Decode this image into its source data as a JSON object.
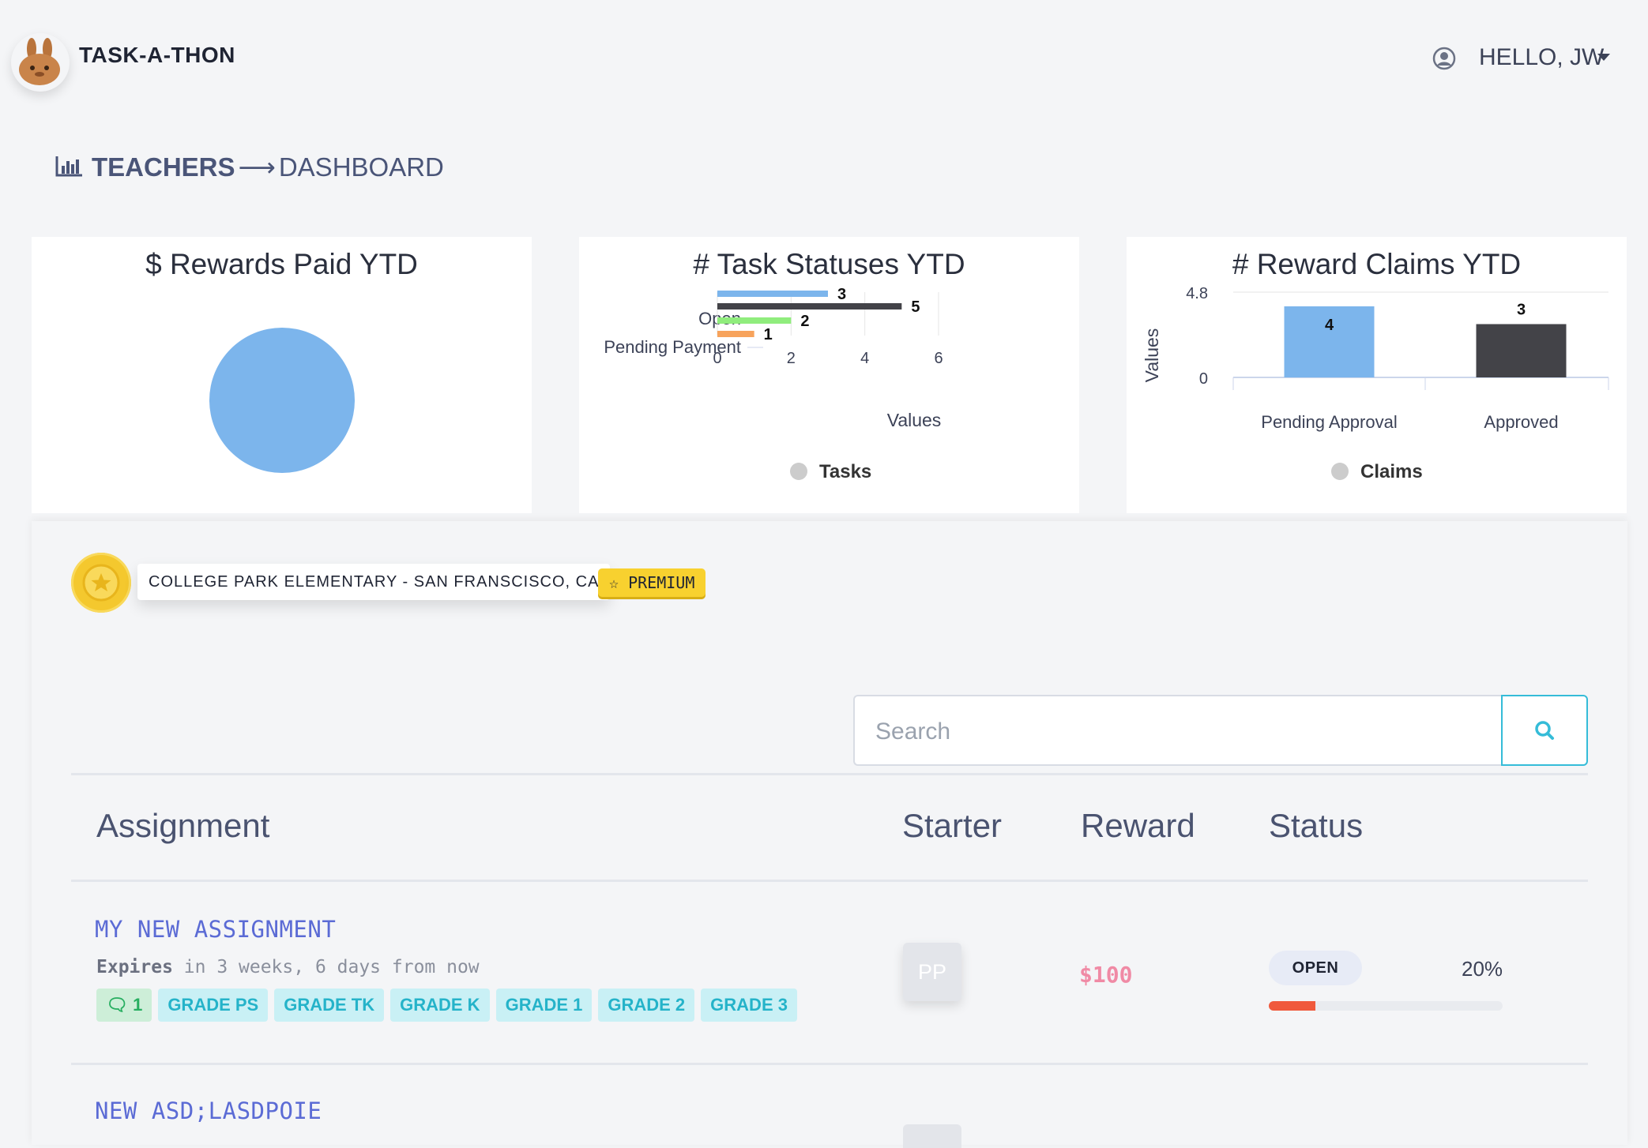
{
  "header": {
    "brand": "TASK-A-THON",
    "user_label": "HELLO, JW"
  },
  "breadcrumb": {
    "section": "TEACHERS",
    "arrow": "⟶",
    "page": "DASHBOARD"
  },
  "cards": {
    "rewards": {
      "title": "$ Rewards Paid YTD"
    },
    "tasks": {
      "title": "# Task Statuses YTD"
    },
    "claims": {
      "title": "# Reward Claims YTD"
    }
  },
  "chart_data": [
    {
      "type": "pie",
      "title": "$ Rewards Paid YTD",
      "slices": [
        {
          "label": "",
          "value": 1,
          "color": "#7cb5ec"
        }
      ]
    },
    {
      "type": "bar",
      "orientation": "horizontal",
      "title": "# Task Statuses YTD",
      "categories": [
        "Open",
        "Pending Payment"
      ],
      "bars": [
        {
          "value": 3,
          "color": "#7cb5ec"
        },
        {
          "value": 5,
          "color": "#434348"
        },
        {
          "value": 2,
          "color": "#90ed7d"
        },
        {
          "value": 1,
          "color": "#f7a35c"
        }
      ],
      "xlabel": "Values",
      "xticks": [
        0,
        2,
        4,
        6
      ],
      "xlim": [
        0,
        6
      ],
      "legend": {
        "label": "Tasks",
        "placement": "bottom"
      }
    },
    {
      "type": "bar",
      "title": "# Reward Claims YTD",
      "categories": [
        "Pending Approval",
        "Approved"
      ],
      "values": [
        4,
        3
      ],
      "colors": [
        "#7cb5ec",
        "#434348"
      ],
      "ylabel": "Values",
      "yticks": [
        "0",
        "4.8"
      ],
      "ylim": [
        0,
        4.8
      ],
      "legend": {
        "label": "Claims",
        "placement": "bottom"
      }
    }
  ],
  "school": {
    "name": "COLLEGE PARK ELEMENTARY - SAN FRANSCISCO, CA",
    "badge": "PREMIUM"
  },
  "search": {
    "placeholder": "Search"
  },
  "table": {
    "headers": {
      "assignment": "Assignment",
      "starter": "Starter",
      "reward": "Reward",
      "status": "Status"
    },
    "rows": [
      {
        "title": "MY NEW ASSIGNMENT",
        "expires_label": "Expires",
        "expires_text": " in 3 weeks, 6 days from now",
        "comments": "1",
        "tags": [
          "GRADE PS",
          "GRADE TK",
          "GRADE K",
          "GRADE 1",
          "GRADE 2",
          "GRADE 3"
        ],
        "starter": "PP",
        "reward": "$100",
        "status": "OPEN",
        "percent": "20%",
        "progress": 0.2
      },
      {
        "title": "NEW ASD;LASDPOIE"
      }
    ]
  }
}
